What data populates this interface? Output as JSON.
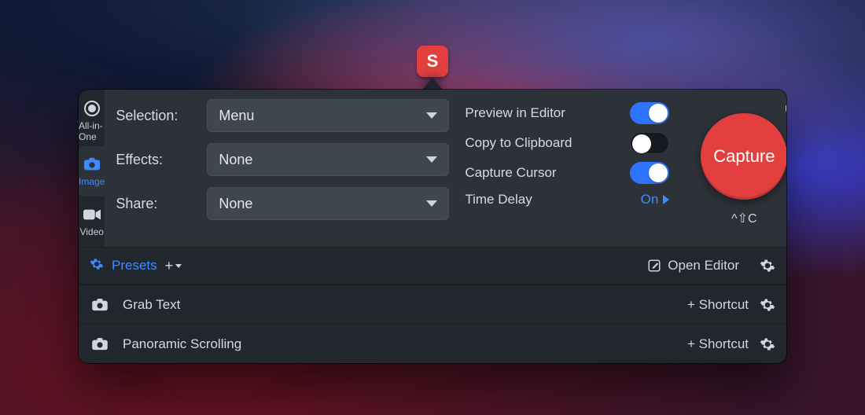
{
  "app": {
    "glyph": "S"
  },
  "modes": {
    "all": {
      "label": "All-in-One"
    },
    "image": {
      "label": "Image"
    },
    "video": {
      "label": "Video"
    }
  },
  "settings": {
    "selection": {
      "label": "Selection:",
      "value": "Menu"
    },
    "effects": {
      "label": "Effects:",
      "value": "None"
    },
    "share": {
      "label": "Share:",
      "value": "None"
    }
  },
  "toggles": {
    "preview": {
      "label": "Preview in Editor"
    },
    "clipboard": {
      "label": "Copy to Clipboard"
    },
    "cursor": {
      "label": "Capture Cursor"
    },
    "delay": {
      "label": "Time Delay",
      "value": "On"
    }
  },
  "capture": {
    "label": "Capture",
    "shortcut": "^⇧C"
  },
  "presetsBar": {
    "label": "Presets",
    "openEditor": "Open Editor"
  },
  "presets": {
    "grabText": {
      "label": "Grab Text",
      "shortcut": "+ Shortcut"
    },
    "panoramic": {
      "label": "Panoramic Scrolling",
      "shortcut": "+ Shortcut"
    }
  }
}
